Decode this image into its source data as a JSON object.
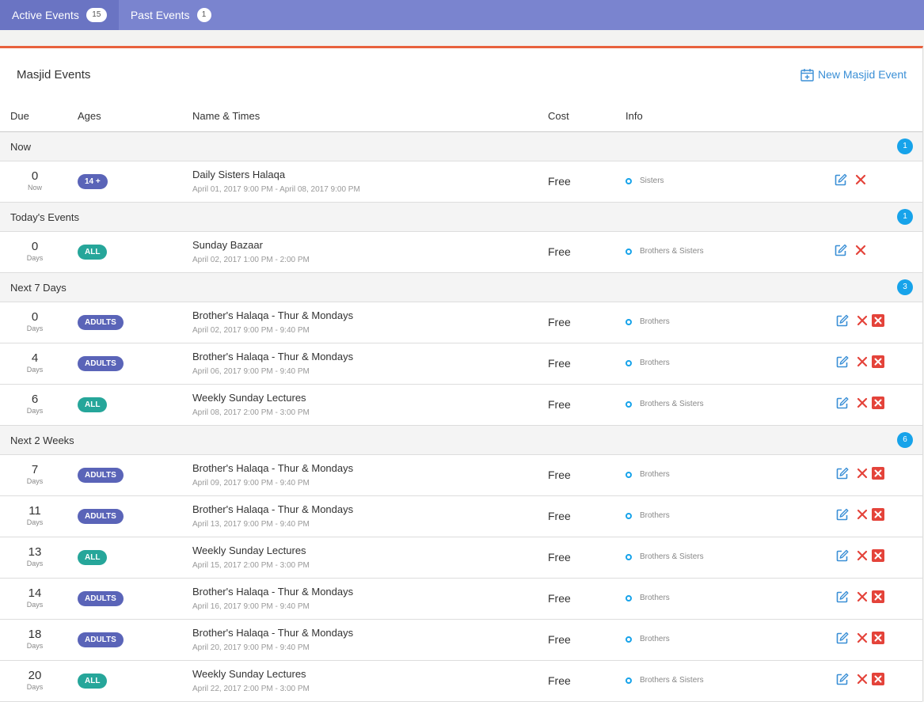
{
  "tabs": [
    {
      "label": "Active Events",
      "count": "15"
    },
    {
      "label": "Past Events",
      "count": "1"
    }
  ],
  "panel": {
    "title": "Masjid Events",
    "new_button": "New Masjid Event"
  },
  "columns": {
    "due": "Due",
    "ages": "Ages",
    "name": "Name & Times",
    "cost": "Cost",
    "info": "Info"
  },
  "colors": {
    "tabbar": "#7a84cf",
    "accent": "#e8613d",
    "link": "#3a8fd6",
    "badge": "#17a3ea",
    "adults": "#5a64b8",
    "all": "#26a69a",
    "delete": "#e4433a"
  },
  "groups": [
    {
      "label": "Now",
      "count": "1",
      "rows": [
        {
          "due": "0",
          "unit": "Now",
          "age": "14 +",
          "age_kind": "age14",
          "name": "Daily Sisters Halaqa",
          "time": "April 01, 2017 9:00 PM - April 08, 2017 9:00 PM",
          "cost": "Free",
          "info": "Sisters",
          "actions": 2
        }
      ]
    },
    {
      "label": "Today's Events",
      "count": "1",
      "rows": [
        {
          "due": "0",
          "unit": "Days",
          "age": "ALL",
          "age_kind": "all",
          "name": "Sunday Bazaar",
          "time": "April 02, 2017 1:00 PM - 2:00 PM",
          "cost": "Free",
          "info": "Brothers & Sisters",
          "actions": 2
        }
      ]
    },
    {
      "label": "Next 7 Days",
      "count": "3",
      "rows": [
        {
          "due": "0",
          "unit": "Days",
          "age": "ADULTS",
          "age_kind": "adults",
          "name": "Brother's Halaqa - Thur & Mondays",
          "time": "April 02, 2017 9:00 PM - 9:40 PM",
          "cost": "Free",
          "info": "Brothers",
          "actions": 3
        },
        {
          "due": "4",
          "unit": "Days",
          "age": "ADULTS",
          "age_kind": "adults",
          "name": "Brother's Halaqa - Thur & Mondays",
          "time": "April 06, 2017 9:00 PM - 9:40 PM",
          "cost": "Free",
          "info": "Brothers",
          "actions": 3
        },
        {
          "due": "6",
          "unit": "Days",
          "age": "ALL",
          "age_kind": "all",
          "name": "Weekly Sunday Lectures",
          "time": "April 08, 2017 2:00 PM - 3:00 PM",
          "cost": "Free",
          "info": "Brothers & Sisters",
          "actions": 3
        }
      ]
    },
    {
      "label": "Next 2 Weeks",
      "count": "6",
      "rows": [
        {
          "due": "7",
          "unit": "Days",
          "age": "ADULTS",
          "age_kind": "adults",
          "name": "Brother's Halaqa - Thur & Mondays",
          "time": "April 09, 2017 9:00 PM - 9:40 PM",
          "cost": "Free",
          "info": "Brothers",
          "actions": 3
        },
        {
          "due": "11",
          "unit": "Days",
          "age": "ADULTS",
          "age_kind": "adults",
          "name": "Brother's Halaqa - Thur & Mondays",
          "time": "April 13, 2017 9:00 PM - 9:40 PM",
          "cost": "Free",
          "info": "Brothers",
          "actions": 3
        },
        {
          "due": "13",
          "unit": "Days",
          "age": "ALL",
          "age_kind": "all",
          "name": "Weekly Sunday Lectures",
          "time": "April 15, 2017 2:00 PM - 3:00 PM",
          "cost": "Free",
          "info": "Brothers & Sisters",
          "actions": 3
        },
        {
          "due": "14",
          "unit": "Days",
          "age": "ADULTS",
          "age_kind": "adults",
          "name": "Brother's Halaqa - Thur & Mondays",
          "time": "April 16, 2017 9:00 PM - 9:40 PM",
          "cost": "Free",
          "info": "Brothers",
          "actions": 3
        },
        {
          "due": "18",
          "unit": "Days",
          "age": "ADULTS",
          "age_kind": "adults",
          "name": "Brother's Halaqa - Thur & Mondays",
          "time": "April 20, 2017 9:00 PM - 9:40 PM",
          "cost": "Free",
          "info": "Brothers",
          "actions": 3
        },
        {
          "due": "20",
          "unit": "Days",
          "age": "ALL",
          "age_kind": "all",
          "name": "Weekly Sunday Lectures",
          "time": "April 22, 2017 2:00 PM - 3:00 PM",
          "cost": "Free",
          "info": "Brothers & Sisters",
          "actions": 3
        }
      ]
    }
  ]
}
